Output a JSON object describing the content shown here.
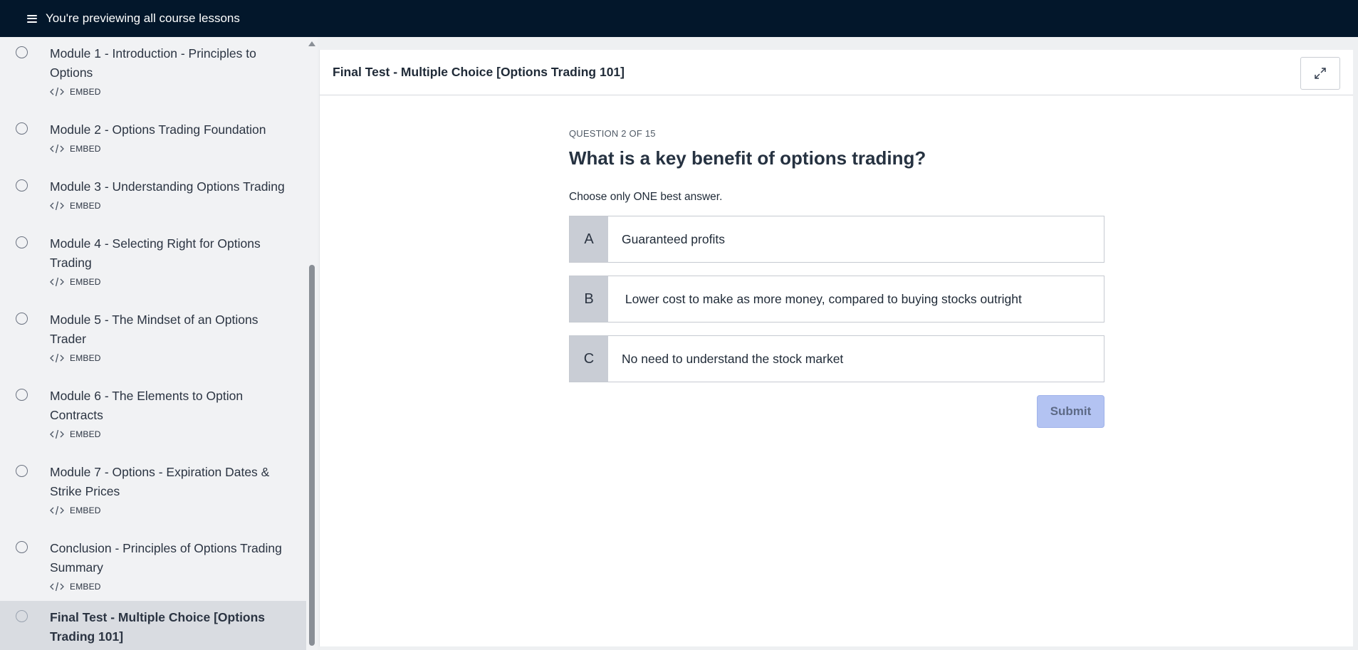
{
  "topbar": {
    "title": "You're previewing all course lessons"
  },
  "sidebar": {
    "lessons": [
      {
        "title": "Module 1 - Introduction - Principles to Options",
        "type": "EMBED",
        "icon": "embed-icon"
      },
      {
        "title": "Module 2 - Options Trading Foundation",
        "type": "EMBED",
        "icon": "embed-icon"
      },
      {
        "title": "Module 3 - Understanding Options Trading",
        "type": "EMBED",
        "icon": "embed-icon"
      },
      {
        "title": "Module 4 - Selecting Right for Options Trading",
        "type": "EMBED",
        "icon": "embed-icon"
      },
      {
        "title": "Module 5 - The Mindset of an Options Trader",
        "type": "EMBED",
        "icon": "embed-icon"
      },
      {
        "title": "Module 6 - The Elements to Option Contracts",
        "type": "EMBED",
        "icon": "embed-icon"
      },
      {
        "title": "Module 7 - Options - Expiration Dates & Strike Prices",
        "type": "EMBED",
        "icon": "embed-icon"
      },
      {
        "title": "Conclusion - Principles of Options Trading Summary",
        "type": "EMBED",
        "icon": "embed-icon"
      },
      {
        "title": "Final Test - Multiple Choice [Options Trading 101]",
        "type": "QUIZ",
        "icon": "quiz-icon",
        "active": true
      }
    ]
  },
  "main": {
    "heading_bold": "Final Test - Multiple Choice [",
    "heading_rest": "Options Trading 101]"
  },
  "quiz": {
    "counter": "QUESTION 2 OF 15",
    "question": "What is a key benefit of options trading?",
    "instruction": "Choose only ONE best answer.",
    "options": [
      {
        "letter": "A",
        "text": "Guaranteed profits"
      },
      {
        "letter": "B",
        "text": " Lower cost to make as more money, compared to buying stocks outright"
      },
      {
        "letter": "C",
        "text": "No need to understand the stock market"
      }
    ],
    "submit_label": "Submit"
  },
  "colors": {
    "topbar": "#03172b",
    "submit": "#b3c3f2",
    "active_lesson": "#d9dce1"
  }
}
